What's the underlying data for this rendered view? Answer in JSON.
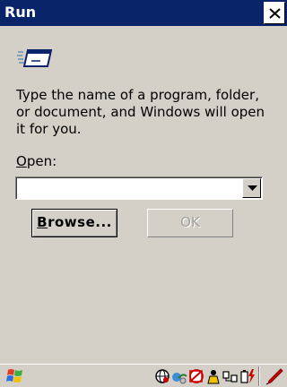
{
  "window": {
    "title": "Run"
  },
  "dialog": {
    "description": "Type the name of a program, folder,\nor document, and Windows will open\nit for you.",
    "open_label_mnemonic": "O",
    "open_label_rest": "pen:",
    "open_value": "",
    "browse_mnemonic": "B",
    "browse_rest": "rowse...",
    "ok_label": "OK"
  },
  "icons": {
    "run": "run-icon",
    "close": "close-icon",
    "dropdown": "chevron-down-icon",
    "start": "windows-logo-icon",
    "tray": [
      "network-globe-icon",
      "connection-icon",
      "no-signal-icon",
      "user-icon",
      "pc-link-icon",
      "battery-charge-icon"
    ],
    "pen": "pen-icon"
  },
  "colors": {
    "titlebar": "#0a246a",
    "face": "#d4d0c8",
    "accent_red": "#cc0000"
  }
}
